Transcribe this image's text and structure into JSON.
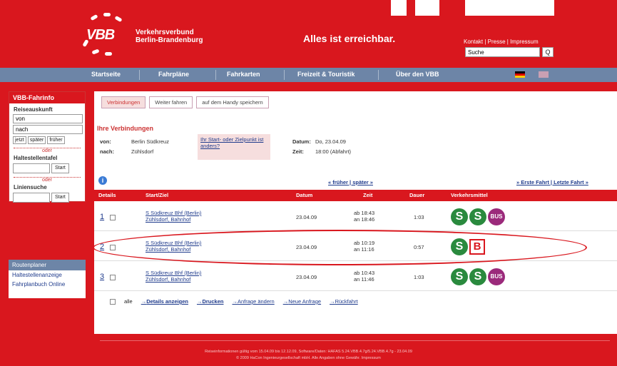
{
  "header": {
    "logo_text": "VBB",
    "org_line1": "Verkehrsverbund",
    "org_line2": "Berlin-Brandenburg",
    "slogan": "Alles ist erreichbar.",
    "toplinks": "Kontakt | Presse | Impressum",
    "search_value": "Suche",
    "search_button": "Q"
  },
  "nav": [
    "Startseite",
    "Fahrpläne",
    "Fahrkarten",
    "Freizeit & Touristik",
    "Über den VBB"
  ],
  "sidebar": {
    "title": "VBB-Fahrinfo",
    "section1": "Reiseauskunft",
    "from_value": "von",
    "to_value": "nach",
    "btn_now": "jetzt",
    "btn_later": "später",
    "btn_earlier": "früher",
    "divider": "oder",
    "section2": "Haltestellentafel",
    "start1": "Start",
    "section3": "Liniensuche",
    "start2": "Start"
  },
  "sidebar2": {
    "head": "Routenplaner",
    "items": [
      "Haltestellenanzeige",
      "Fahrplanbuch Online"
    ]
  },
  "tabs": [
    "Verbindungen",
    "Weiter fahren",
    "auf dem Handy speichern"
  ],
  "summary": {
    "title": "Ihre Verbindungen",
    "von_label": "von:",
    "von_value": "Berlin Südkreuz",
    "nach_label": "nach:",
    "nach_value": "Zühlsdorf",
    "change_link": "Ihr Start- oder Zielpunkt ist anders?",
    "datum_label": "Datum:",
    "datum_value": "Do, 23.04.09",
    "zeit_label": "Zeit:",
    "zeit_value": "18:00 (Abfahrt)"
  },
  "pager": {
    "info": "i",
    "earlier_later": "« früher | später »",
    "first_last": "» Erste Fahrt | Letzte Fahrt »"
  },
  "table": {
    "headers": [
      "Details",
      "Start/Ziel",
      "Datum",
      "Zeit",
      "Dauer",
      "Verkehrsmittel"
    ],
    "rows": [
      {
        "num": "1",
        "start": "S Südkreuz Bhf (Berlin)",
        "ziel": "Zühlsdorf, Bahnhof",
        "date": "23.04.09",
        "dep": "ab 18:43",
        "arr": "an 18:46",
        "dur": "1:03",
        "icons": [
          "S",
          "S",
          "BUS"
        ]
      },
      {
        "num": "2",
        "start": "S Südkreuz Bhf (Berlin)",
        "ziel": "Zühlsdorf, Bahnhof",
        "date": "23.04.09",
        "dep": "ab 10:19",
        "arr": "an 11:16",
        "dur": "0:57",
        "icons": [
          "S",
          "B"
        ]
      },
      {
        "num": "3",
        "start": "S Südkreuz Bhf (Berlin)",
        "ziel": "Zühlsdorf, Bahnhof",
        "date": "23.04.09",
        "dep": "ab 10:43",
        "arr": "an 11:46",
        "dur": "1:03",
        "icons": [
          "S",
          "S",
          "BUS"
        ]
      }
    ]
  },
  "actions": {
    "all_label": "alle",
    "details": "Details anzeigen",
    "print": "Drucken",
    "change": "Anfrage ändern",
    "new": "Neue Anfrage",
    "back": "Rückfahrt"
  },
  "footer": {
    "line1": "Reiseinformationen gültig vom 15.04.09 bis 12.12.09, Software/Daten: HAFAS 5.24.VBB.4.7g/5.24.VBB.4.7g - 23.04.09",
    "line2": "© 2009 HaCon Ingenieurgesellschaft mbH. Alle Angaben ohne Gewähr. Impressum"
  }
}
